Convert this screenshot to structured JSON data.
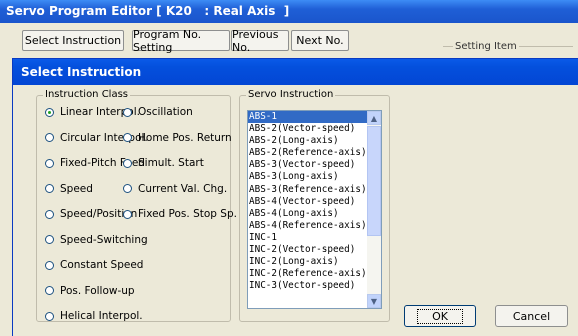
{
  "outer_window": {
    "title": "Servo Program Editor [ K20   : Real Axis  ]"
  },
  "toolbar": {
    "select_instruction": "Select Instruction",
    "program_no_setting": "Program No. Setting",
    "previous_no": "Previous No.",
    "next_no": "Next No."
  },
  "setting_item": {
    "label": "Setting Item"
  },
  "dialog": {
    "title": "Select Instruction",
    "instruction_class": {
      "label": "Instruction Class",
      "col1": [
        "Linear Interpol.",
        "Circular Interpol.",
        "Fixed-Pitch Feed",
        "Speed",
        "Speed/Position",
        "Speed-Switching",
        "Constant Speed",
        "Pos. Follow-up",
        "Helical Interpol."
      ],
      "col2": [
        "Oscillation",
        "Home Pos. Return",
        "Simult. Start",
        "Current Val. Chg.",
        "Fixed Pos. Stop Sp."
      ],
      "selected": "Linear Interpol."
    },
    "servo_instruction": {
      "label": "Servo Instruction",
      "items": [
        "ABS-1",
        "ABS-2(Vector-speed)",
        "ABS-2(Long-axis)",
        "ABS-2(Reference-axis)",
        "ABS-3(Vector-speed)",
        "ABS-3(Long-axis)",
        "ABS-3(Reference-axis)",
        "ABS-4(Vector-speed)",
        "ABS-4(Long-axis)",
        "ABS-4(Reference-axis)",
        "INC-1",
        "INC-2(Vector-speed)",
        "INC-2(Long-axis)",
        "INC-2(Reference-axis)",
        "INC-3(Vector-speed)"
      ],
      "selected": "ABS-1"
    },
    "ok_label": "OK",
    "cancel_label": "Cancel"
  }
}
